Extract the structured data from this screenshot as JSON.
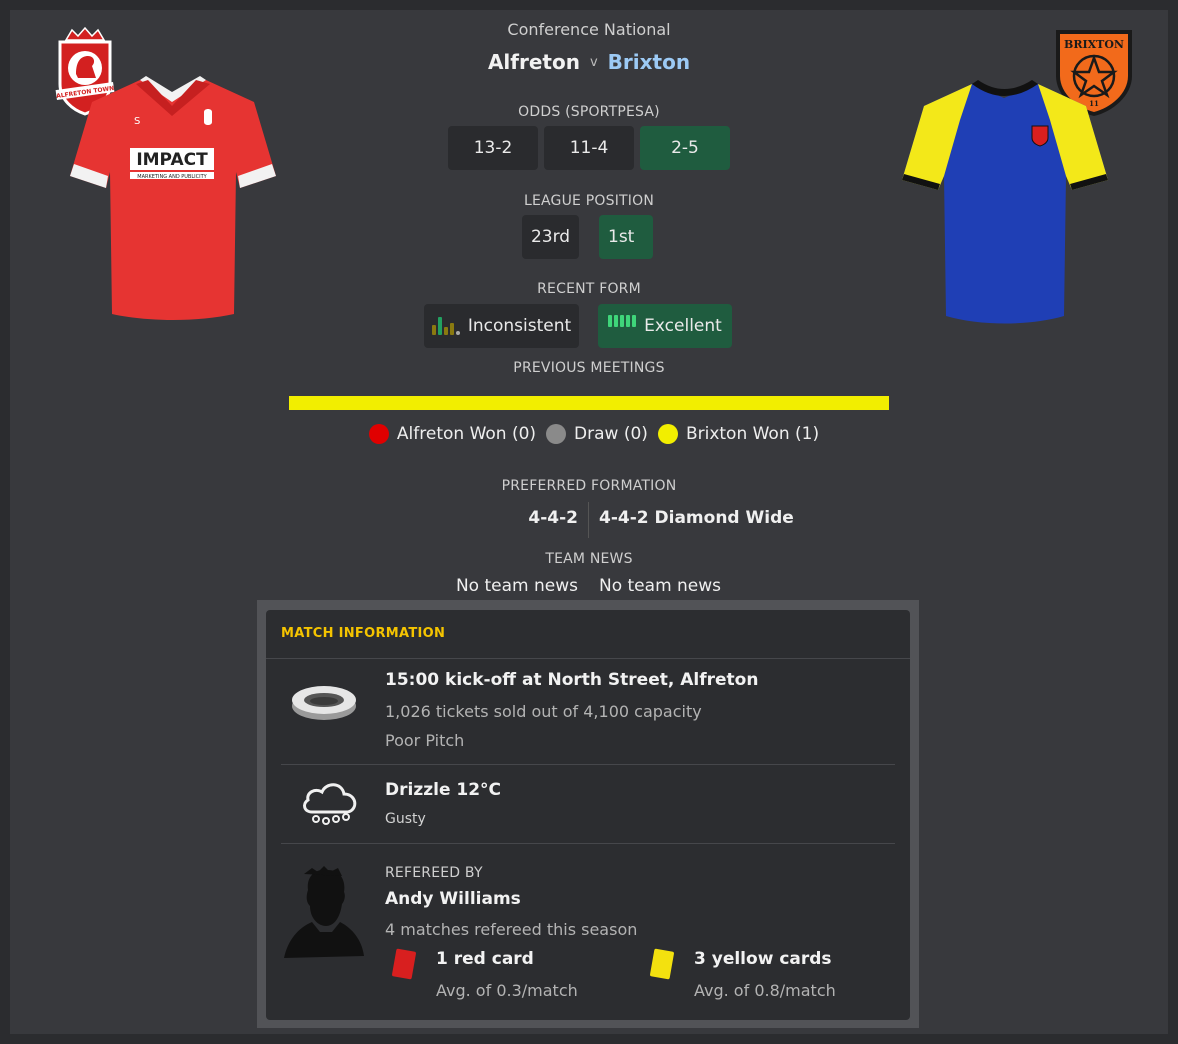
{
  "header": {
    "competition": "Conference National",
    "home_team": "Alfreton",
    "versus": "v",
    "away_team": "Brixton",
    "home_badge_text": "ALFRETON TOWN",
    "away_badge_text": "BRIXTON",
    "away_badge_sub": "11",
    "home_sponsor": "IMPACT",
    "home_sponsor_sub": "MARKETING AND PUBLICITY"
  },
  "odds": {
    "label": "ODDS (SPORTPESA)",
    "home": "13-2",
    "draw": "11-4",
    "away": "2-5"
  },
  "league_position": {
    "label": "LEAGUE POSITION",
    "home": "23rd",
    "away": "1st"
  },
  "recent_form": {
    "label": "RECENT FORM",
    "home": "Inconsistent",
    "away": "Excellent"
  },
  "previous_meetings": {
    "label": "PREVIOUS MEETINGS",
    "home_won": "Alfreton Won (0)",
    "draw": "Draw (0)",
    "away_won": "Brixton Won (1)",
    "counts": {
      "home": 0,
      "draw": 0,
      "away": 1
    },
    "colors": {
      "home": "#e00000",
      "draw": "#8a8a8a",
      "away": "#f2ee00"
    }
  },
  "preferred_formation": {
    "label": "PREFERRED FORMATION",
    "home": "4-4-2",
    "away": "4-4-2 Diamond Wide"
  },
  "team_news": {
    "label": "TEAM NEWS",
    "home": "No team news",
    "away": "No team news"
  },
  "match_info": {
    "title": "MATCH INFORMATION",
    "venue": {
      "title": "15:00 kick-off at North Street, Alfreton",
      "tickets": "1,026 tickets sold out of 4,100 capacity",
      "pitch": "Poor Pitch"
    },
    "weather": {
      "title": "Drizzle 12°C",
      "wind": "Gusty"
    },
    "referee": {
      "label": "REFEREED BY",
      "name": "Andy Williams",
      "matches": "4 matches refereed this season",
      "red_cards": "1 red card",
      "red_avg": "Avg. of 0.3/match",
      "yellow_cards": "3 yellow cards",
      "yellow_avg": "Avg. of 0.8/match"
    }
  },
  "colors": {
    "accent_yellow": "#f5c400",
    "away_team_blue": "#9ccaf5",
    "pill_green": "#1f5c3f",
    "pill_dark": "#2a2b2e"
  }
}
